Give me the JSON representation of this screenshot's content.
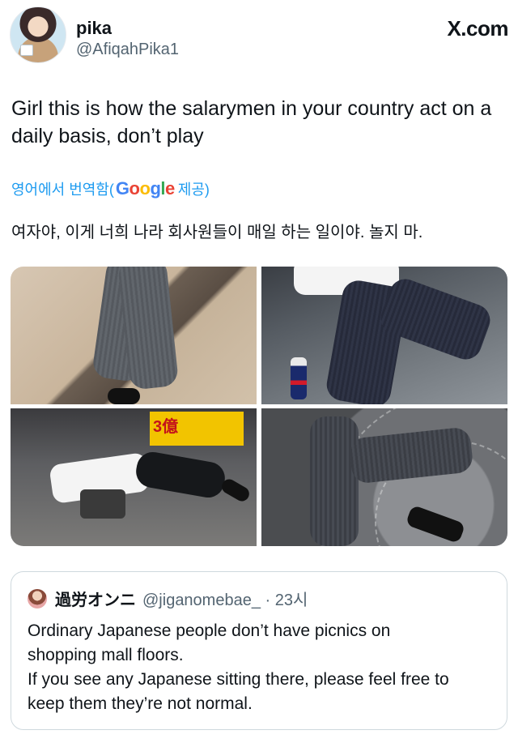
{
  "header": {
    "display_name": "pika",
    "handle": "@AfiqahPika1",
    "site": "X.com"
  },
  "tweet": {
    "text": "Girl this is how the salarymen in your country act on a daily basis, don’t play",
    "translate_prefix": "영어에서 번역함(",
    "translate_brand": "Google",
    "translate_suffix": " 제공)",
    "translated_text": "여자야, 이게 너희 나라 회사원들이 매일 하는 일이야. 놀지 마.",
    "sign_text": "3億"
  },
  "quote": {
    "name": "過労オンニ",
    "handle_time": "@jiganomebae_ · 23시",
    "text_lines": [
      "Ordinary Japanese people don’t have picnics on",
      "shopping mall floors.",
      "If you see any Japanese sitting there, please feel free to",
      "keep them they’re not normal."
    ]
  },
  "colors": {
    "link": "#1d9bf0",
    "text": "#0f1419",
    "secondary": "#536471",
    "border": "#cfd9de"
  },
  "icons": [
    "avatar",
    "x-logo",
    "google-logo",
    "quote-avatar"
  ]
}
